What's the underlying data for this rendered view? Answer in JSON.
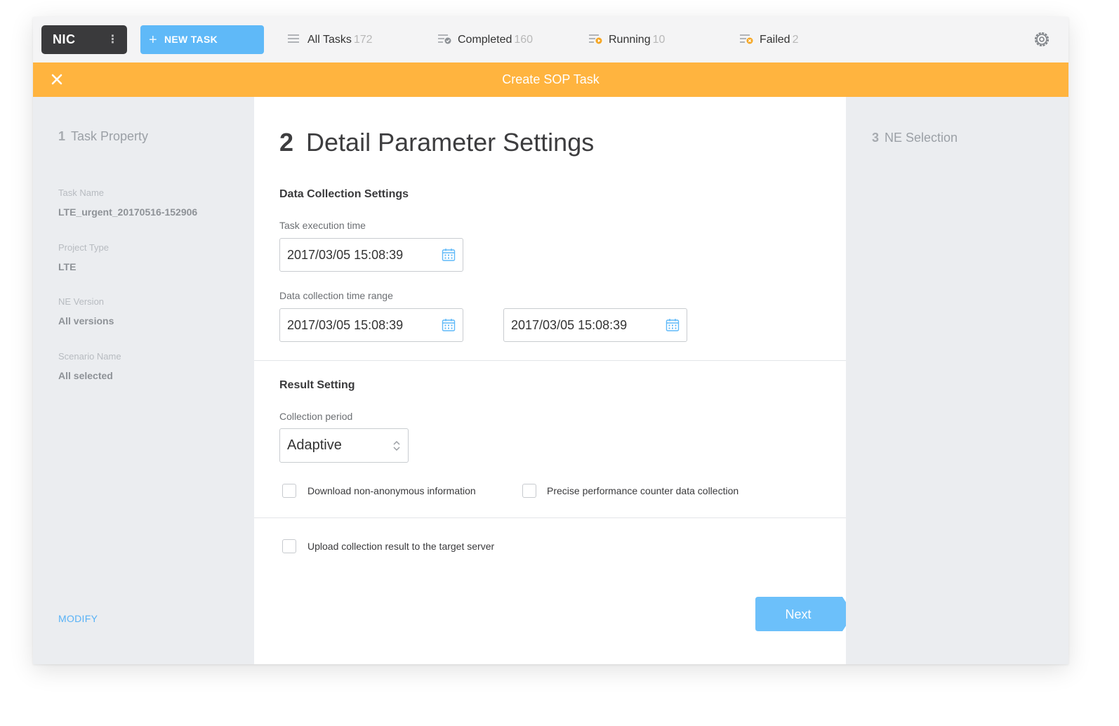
{
  "app": {
    "logo": "NIC",
    "new_task_label": "NEW TASK"
  },
  "tabs": [
    {
      "label": "All Tasks",
      "count": "172",
      "icon": "list-icon"
    },
    {
      "label": "Completed",
      "count": "160",
      "icon": "list-check-icon"
    },
    {
      "label": "Running",
      "count": "10",
      "icon": "list-running-icon"
    },
    {
      "label": "Failed",
      "count": "2",
      "icon": "list-failed-icon"
    }
  ],
  "header": {
    "title": "Create SOP Task"
  },
  "steps": {
    "step1": {
      "num": "1",
      "label": "Task Property"
    },
    "step2": {
      "num": "2",
      "label": "Detail Parameter Settings"
    },
    "step3": {
      "num": "3",
      "label": "NE Selection"
    }
  },
  "summary": {
    "fields": [
      {
        "label": "Task Name",
        "value": "LTE_urgent_20170516-152906"
      },
      {
        "label": "Project Type",
        "value": "LTE"
      },
      {
        "label": "NE Version",
        "value": "All versions"
      },
      {
        "label": "Scenario Name",
        "value": "All selected"
      }
    ],
    "modify_label": "MODIFY"
  },
  "data_collection": {
    "title": "Data Collection Settings",
    "exec_time_label": "Task execution time",
    "exec_time_value": "2017/03/05 15:08:39",
    "range_label": "Data collection time range",
    "range_start": "2017/03/05 15:08:39",
    "range_end": "2017/03/05 15:08:39"
  },
  "result_setting": {
    "title": "Result Setting",
    "period_label": "Collection period",
    "period_value": "Adaptive",
    "checkbox_download": "Download non-anonymous information",
    "checkbox_precise": "Precise performance counter data collection",
    "checkbox_upload": "Upload collection result to the target server"
  },
  "actions": {
    "next_label": "Next"
  },
  "colors": {
    "accent_blue": "#5fb9f8",
    "header_orange": "#ffb43f",
    "logo_dark": "#3a3a3c",
    "panel_gray": "#ebedf0"
  }
}
